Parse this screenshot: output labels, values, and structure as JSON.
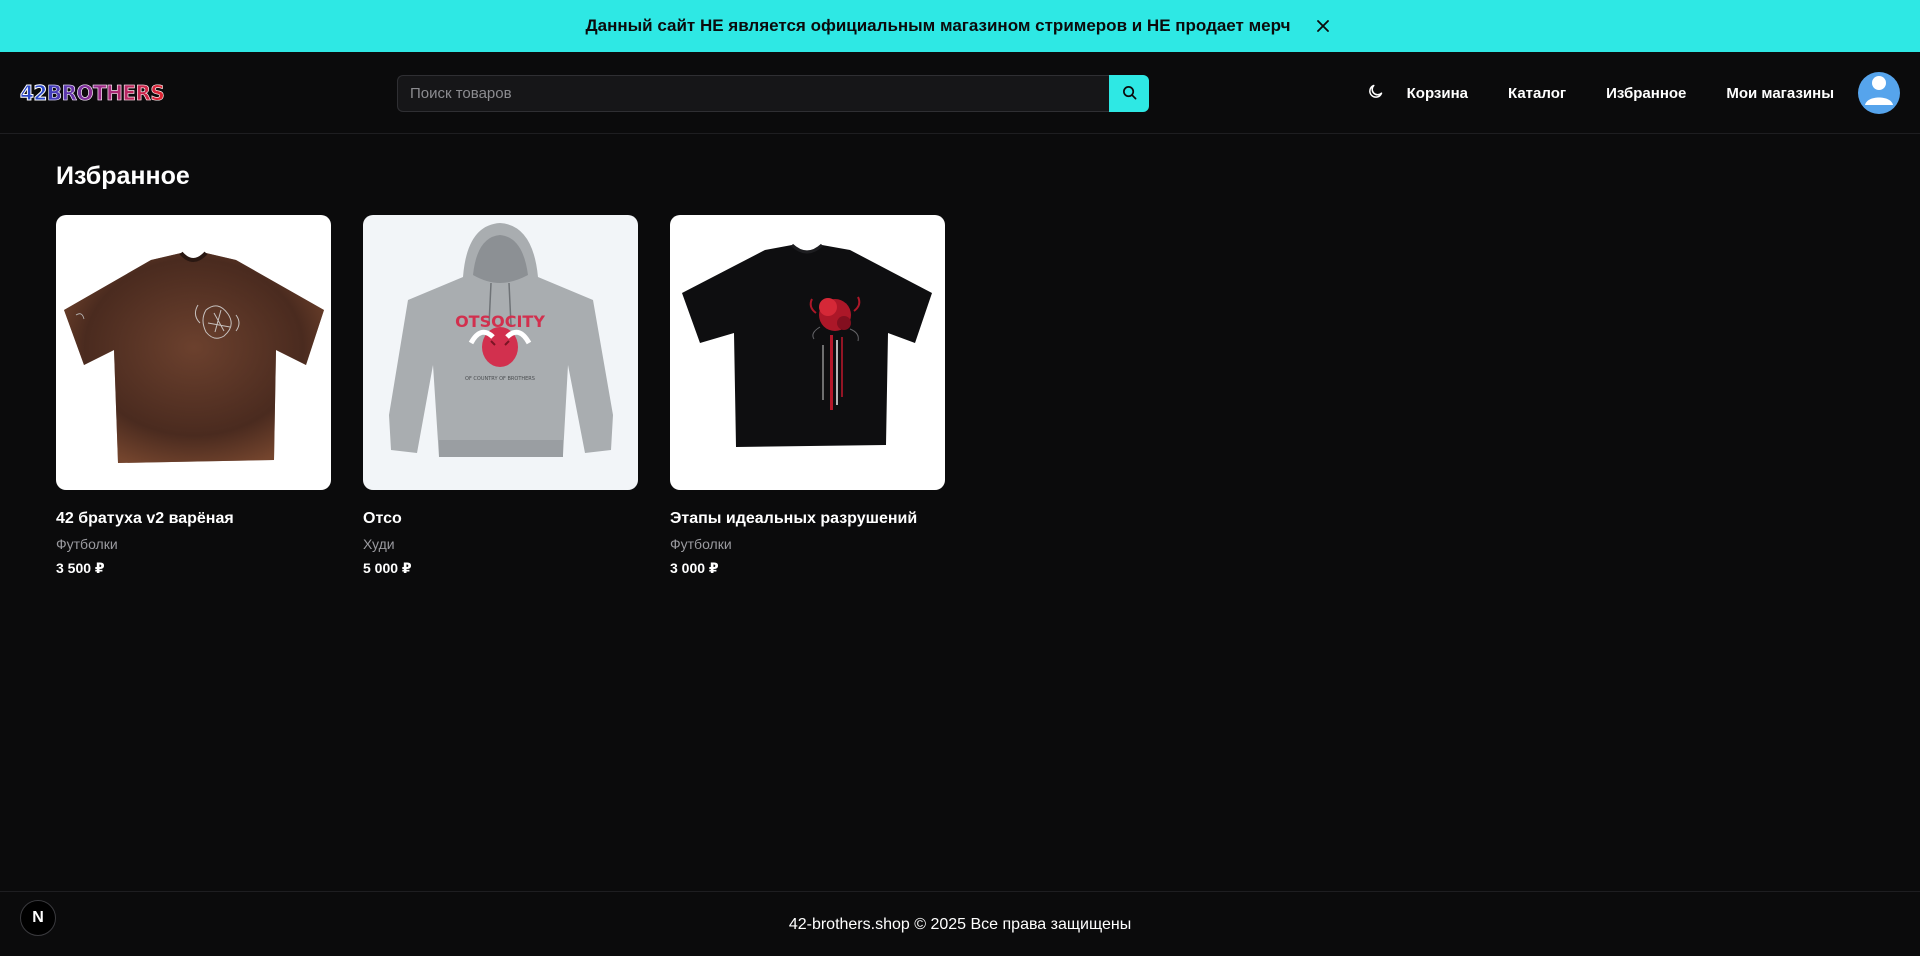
{
  "banner": {
    "text": "Данный сайт НЕ является официальным магазином стримеров и НЕ продает мерч",
    "close_icon": "close-icon"
  },
  "header": {
    "logo_num": "42",
    "logo_word": "BROTHERS",
    "search": {
      "placeholder": "Поиск товаров",
      "value": "",
      "icon": "search-icon"
    },
    "theme_icon": "moon-icon",
    "nav": [
      "Корзина",
      "Каталог",
      "Избранное",
      "Мои магазины"
    ],
    "avatar_icon": "user-icon"
  },
  "page": {
    "title": "Избранное"
  },
  "products": [
    {
      "title": "42 братуха v2 варёная",
      "category": "Футболки",
      "price": "3 500 ₽",
      "image": "brown-washed-tshirt",
      "image_bg": "#ffffff",
      "garment_color": "#5a3526"
    },
    {
      "title": "Отсо",
      "category": "Худи",
      "price": "5 000 ₽",
      "image": "grey-hoodie",
      "image_bg": "#f2f5f8",
      "garment_color": "#a9adb0"
    },
    {
      "title": "Этапы идеальных разрушений",
      "category": "Футболки",
      "price": "3 000 ₽",
      "image": "black-tshirt",
      "image_bg": "#ffffff",
      "garment_color": "#0e0e10"
    }
  ],
  "footer": {
    "text": "42-brothers.shop © 2025 Все права защищены"
  },
  "dev_badge": {
    "label": "N"
  },
  "colors": {
    "accent": "#2ee8e4",
    "background": "#0b0b0c",
    "muted": "#9a9a9f",
    "avatar": "#56a4ec"
  }
}
